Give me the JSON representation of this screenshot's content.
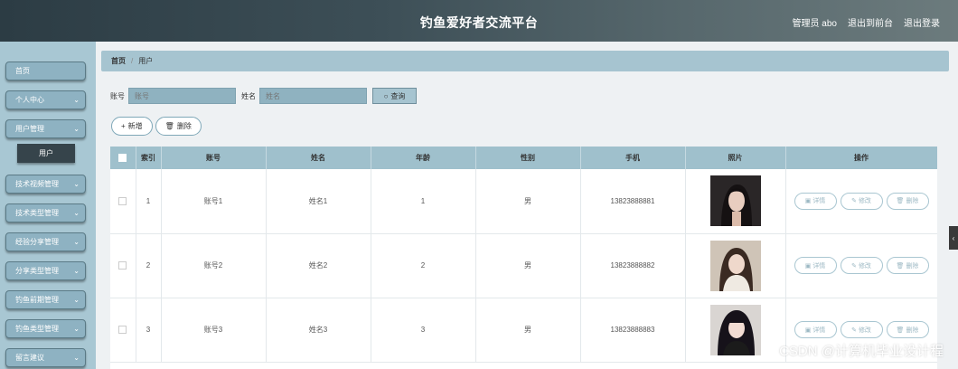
{
  "header": {
    "title": "钓鱼爱好者交流平台",
    "admin_label": "管理员 abo",
    "front_label": "退出到前台",
    "logout_label": "退出登录"
  },
  "sidebar": {
    "items": [
      {
        "label": "首页",
        "has_chevron": false
      },
      {
        "label": "个人中心",
        "has_chevron": true
      },
      {
        "label": "用户管理",
        "has_chevron": true
      },
      {
        "label": "技术视频管理",
        "has_chevron": true
      },
      {
        "label": "技术类型管理",
        "has_chevron": true
      },
      {
        "label": "经验分享管理",
        "has_chevron": true
      },
      {
        "label": "分享类型管理",
        "has_chevron": true
      },
      {
        "label": "钓鱼前期管理",
        "has_chevron": true
      },
      {
        "label": "钓鱼类型管理",
        "has_chevron": true
      },
      {
        "label": "留言建议",
        "has_chevron": true
      }
    ],
    "sub_item": {
      "label": "用户"
    }
  },
  "breadcrumb": {
    "home": "首页",
    "current": "用户"
  },
  "search": {
    "account_label": "账号",
    "account_placeholder": "账号",
    "name_label": "姓名",
    "name_placeholder": "姓名",
    "button_label": "查询"
  },
  "actions": {
    "add_label": "新增",
    "delete_label": "删除"
  },
  "table": {
    "columns": [
      "索引",
      "账号",
      "姓名",
      "年龄",
      "性别",
      "手机",
      "照片",
      "操作"
    ],
    "rows": [
      {
        "index": "1",
        "account": "账号1",
        "name": "姓名1",
        "age": "1",
        "gender": "男",
        "phone": "13823888881"
      },
      {
        "index": "2",
        "account": "账号2",
        "name": "姓名2",
        "age": "2",
        "gender": "男",
        "phone": "13823888882"
      },
      {
        "index": "3",
        "account": "账号3",
        "name": "姓名3",
        "age": "3",
        "gender": "男",
        "phone": "13823888883"
      }
    ],
    "op_labels": {
      "detail": "详情",
      "edit": "修改",
      "delete": "删除"
    }
  },
  "watermark": "CSDN @计算机毕业设计程",
  "colors": {
    "sidebar_bg": "#a8c7d3",
    "header_row": "#9fc0cc",
    "accent": "#8eb2c2"
  }
}
